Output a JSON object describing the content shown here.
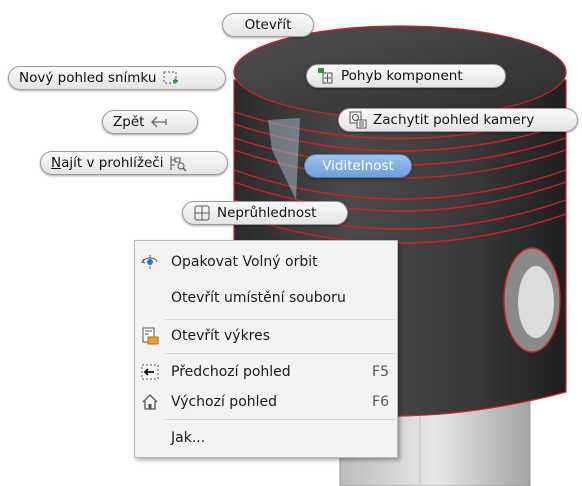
{
  "marking_menu": {
    "open": "Otevřít",
    "new_snapshot_view": "Nový pohled snímku",
    "move_components": "Pohyb komponent",
    "back": "Zpět",
    "capture_camera": "Zachytit pohled kamery",
    "find_in_browser": "Najít v prohlížeči",
    "visibility": "Viditelnost",
    "opacity": "Neprůhlednost"
  },
  "context_menu": {
    "items": [
      {
        "label": "Opakovat Volný orbit",
        "shortcut": "",
        "icon": "free-orbit-icon"
      },
      {
        "label": "Otevřít umístění souboru",
        "shortcut": "",
        "icon": ""
      },
      {
        "label": "Otevřít výkres",
        "shortcut": "",
        "icon": "drawing-icon"
      },
      {
        "label": "Předchozí pohled",
        "shortcut": "F5",
        "icon": "previous-view-icon"
      },
      {
        "label": "Výchozí pohled",
        "shortcut": "F6",
        "icon": "home-view-icon"
      },
      {
        "label": "Jak...",
        "shortcut": "",
        "icon": ""
      }
    ]
  },
  "colors": {
    "model_dark": "#333333",
    "edge_highlight": "#d42020",
    "active_pill": "#7fabe0"
  }
}
